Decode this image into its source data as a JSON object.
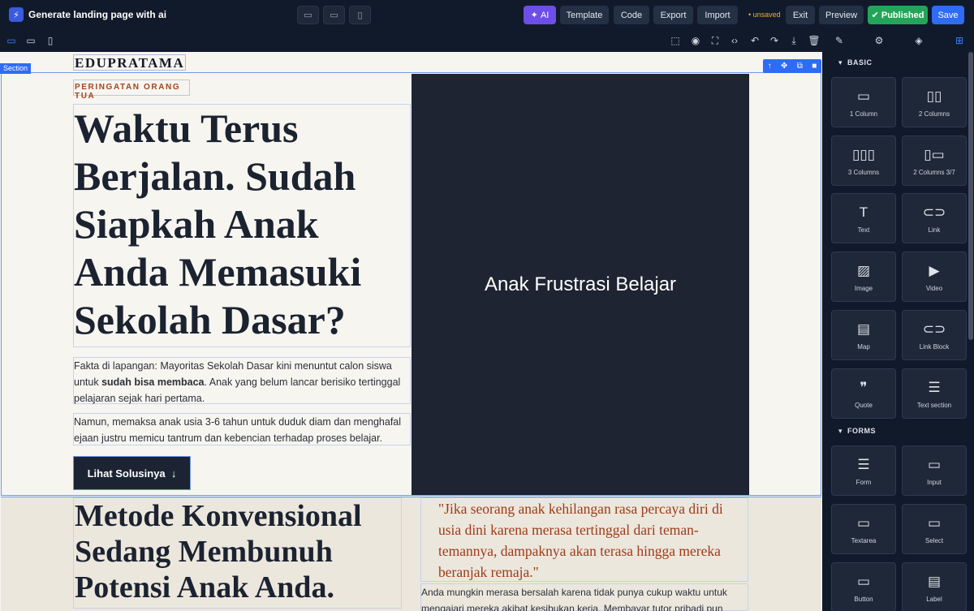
{
  "header": {
    "app_title": "Generate landing page with ai",
    "ai_label": "AI",
    "template_label": "Template",
    "code_label": "Code",
    "export_label": "Export",
    "import_label": "Import",
    "unsaved_label": "• unsaved",
    "exit_label": "Exit",
    "preview_label": "Preview",
    "published_label": "Published",
    "save_label": "Save"
  },
  "canvas": {
    "section_label": "Section",
    "brand": "EDUPRATAMA",
    "eyebrow": "PERINGATAN ORANG TUA",
    "headline": "Waktu Terus Berjalan. Sudah Siapkah Anak Anda Memasuki Sekolah Dasar?",
    "p1_before": "Fakta di lapangan: Mayoritas Sekolah Dasar kini menuntut calon siswa untuk ",
    "p1_bold": "sudah bisa membaca",
    "p1_after": ". Anak yang belum lancar berisiko tertinggal pelajaran sejak hari pertama.",
    "p2": "Namun, memaksa anak usia 3-6 tahun untuk duduk diam dan menghafal ejaan justru memicu tantrum dan kebencian terhadap proses belajar.",
    "cta": "Lihat Solusinya",
    "image_label": "Anak Frustrasi Belajar",
    "h2": "Metode Konvensional Sedang Membunuh Potensi Anak Anda.",
    "quote": "\"Jika seorang anak kehilangan rasa percaya diri di usia dini karena merasa tertinggal dari teman-temannya, dampaknya akan terasa hingga mereka beranjak remaja.\"",
    "p3": "Anda mungkin merasa bersalah karena tidak punya cukup waktu untuk mengajari mereka akibat kesibukan kerja. Membayar tutor pribadi pun"
  },
  "sidebar": {
    "basic_label": "BASIC",
    "forms_label": "FORMS",
    "basic_blocks": [
      {
        "label": "1 Column",
        "icon": "one-column-icon"
      },
      {
        "label": "2 Columns",
        "icon": "two-columns-icon"
      },
      {
        "label": "3 Columns",
        "icon": "three-columns-icon"
      },
      {
        "label": "2 Columns 3/7",
        "icon": "two-columns-37-icon"
      },
      {
        "label": "Text",
        "icon": "text-icon"
      },
      {
        "label": "Link",
        "icon": "link-icon"
      },
      {
        "label": "Image",
        "icon": "image-icon"
      },
      {
        "label": "Video",
        "icon": "video-icon"
      },
      {
        "label": "Map",
        "icon": "map-icon"
      },
      {
        "label": "Link Block",
        "icon": "link-block-icon"
      },
      {
        "label": "Quote",
        "icon": "quote-icon"
      },
      {
        "label": "Text section",
        "icon": "text-section-icon"
      }
    ],
    "form_blocks": [
      {
        "label": "Form",
        "icon": "form-icon"
      },
      {
        "label": "Input",
        "icon": "input-icon"
      },
      {
        "label": "Textarea",
        "icon": "textarea-icon"
      },
      {
        "label": "Select",
        "icon": "select-icon"
      },
      {
        "label": "Button",
        "icon": "button-icon"
      },
      {
        "label": "Label",
        "icon": "label-icon"
      }
    ]
  },
  "colors": {
    "ai": "#6d4ee8",
    "published": "#23a559",
    "save": "#2f6cf6",
    "accent_text": "#a4441f"
  }
}
